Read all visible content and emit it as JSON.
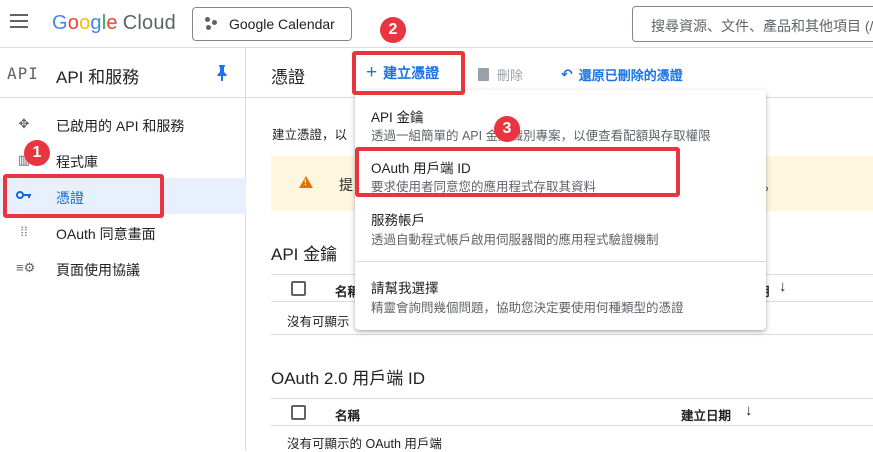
{
  "topbar": {
    "logo_letters": [
      "G",
      "o",
      "o",
      "g",
      "l",
      "e"
    ],
    "logo_suffix": "Cloud",
    "project": "Google Calendar",
    "search_placeholder": "搜尋資源、文件、產品和其他項目 (/)"
  },
  "sidebar": {
    "api_mark": "API",
    "title": "API 和服務",
    "items": [
      {
        "label": "已啟用的 API 和服務",
        "icon": "api-services-icon"
      },
      {
        "label": "程式庫",
        "icon": "library-icon"
      },
      {
        "label": "憑證",
        "icon": "key-icon",
        "active": true
      },
      {
        "label": "OAuth 同意畫面",
        "icon": "oauth-consent-icon"
      },
      {
        "label": "頁面使用協議",
        "icon": "page-agreement-icon"
      }
    ]
  },
  "header": {
    "title": "憑證",
    "create_label": "建立憑證",
    "delete_label": "刪除",
    "restore_label": "還原已刪除的憑證"
  },
  "main": {
    "description": "建立憑證，以",
    "warning_text": "提",
    "warning_tail": "。",
    "api_keys_title": "API 金鑰",
    "api_keys_col_name": "名稱",
    "api_keys_col_date_tail": "期",
    "api_keys_empty": "沒有可顯示",
    "oauth_title": "OAuth 2.0 用戶端 ID",
    "oauth_col_name": "名稱",
    "oauth_col_date": "建立日期",
    "oauth_empty": "沒有可顯示的 OAuth 用戶端"
  },
  "menu": {
    "items": [
      {
        "title": "API 金鑰",
        "desc": "透過一組簡單的 API 金鑰識別專案，以便查看配額與存取權限"
      },
      {
        "title": "OAuth 用戶端 ID",
        "desc": "要求使用者同意您的應用程式存取其資料"
      },
      {
        "title": "服務帳戶",
        "desc": "透過自動程式帳戶啟用伺服器間的應用程式驗證機制"
      },
      {
        "title": "請幫我選擇",
        "desc": "精靈會詢問幾個問題，協助您決定要使用何種類型的憑證"
      }
    ]
  },
  "annotations": {
    "badges": [
      "1",
      "2",
      "3"
    ],
    "color": "#e8353f"
  },
  "colors": {
    "accent": "#1a73e8",
    "active_bg": "#e8f0fe",
    "warning_bg": "#fef7e0"
  }
}
